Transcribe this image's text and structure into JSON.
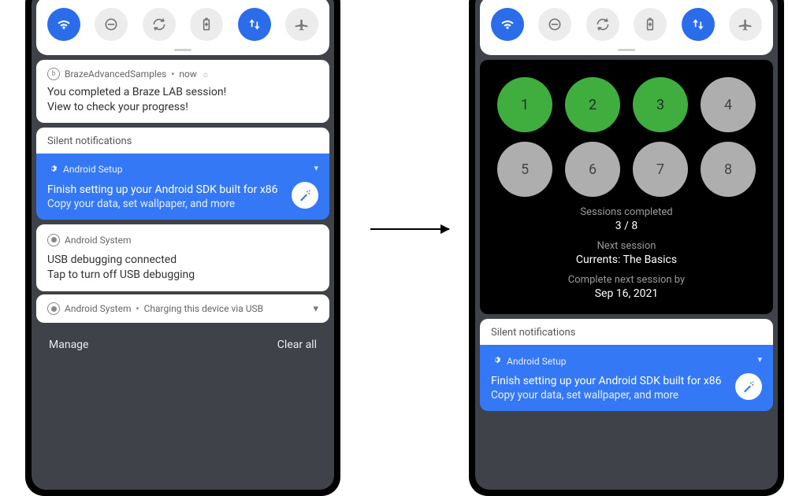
{
  "qs_tiles": [
    {
      "name": "wifi-icon",
      "active": true
    },
    {
      "name": "dnd-icon",
      "active": false
    },
    {
      "name": "rotate-icon",
      "active": false
    },
    {
      "name": "battery-saver-icon",
      "active": false
    },
    {
      "name": "data-icon",
      "active": true
    },
    {
      "name": "airplane-icon",
      "active": false
    }
  ],
  "notif1": {
    "app": "BrazeAdvancedSamples",
    "time": "now",
    "line1": "You completed a Braze LAB session!",
    "line2": "View to check your progress!"
  },
  "silent_header": "Silent notifications",
  "setup": {
    "app": "Android Setup",
    "title": "Finish setting up your Android SDK built for x86",
    "sub": "Copy your data, set wallpaper, and more"
  },
  "sys_usb": {
    "app": "Android System",
    "line1": "USB debugging connected",
    "line2": "Tap to turn off USB debugging"
  },
  "sys_charging": {
    "app": "Android System",
    "text": "Charging this device via USB"
  },
  "footer": {
    "manage": "Manage",
    "clear": "Clear all"
  },
  "progress": {
    "sessions": [
      {
        "n": "1",
        "done": true
      },
      {
        "n": "2",
        "done": true
      },
      {
        "n": "3",
        "done": true
      },
      {
        "n": "4",
        "done": false
      },
      {
        "n": "5",
        "done": false
      },
      {
        "n": "6",
        "done": false
      },
      {
        "n": "7",
        "done": false
      },
      {
        "n": "8",
        "done": false
      }
    ],
    "sessions_label": "Sessions completed",
    "sessions_value": "3 / 8",
    "next_label": "Next session",
    "next_value": "Currents: The Basics",
    "due_label": "Complete next session by",
    "due_value": "Sep 16, 2021"
  }
}
